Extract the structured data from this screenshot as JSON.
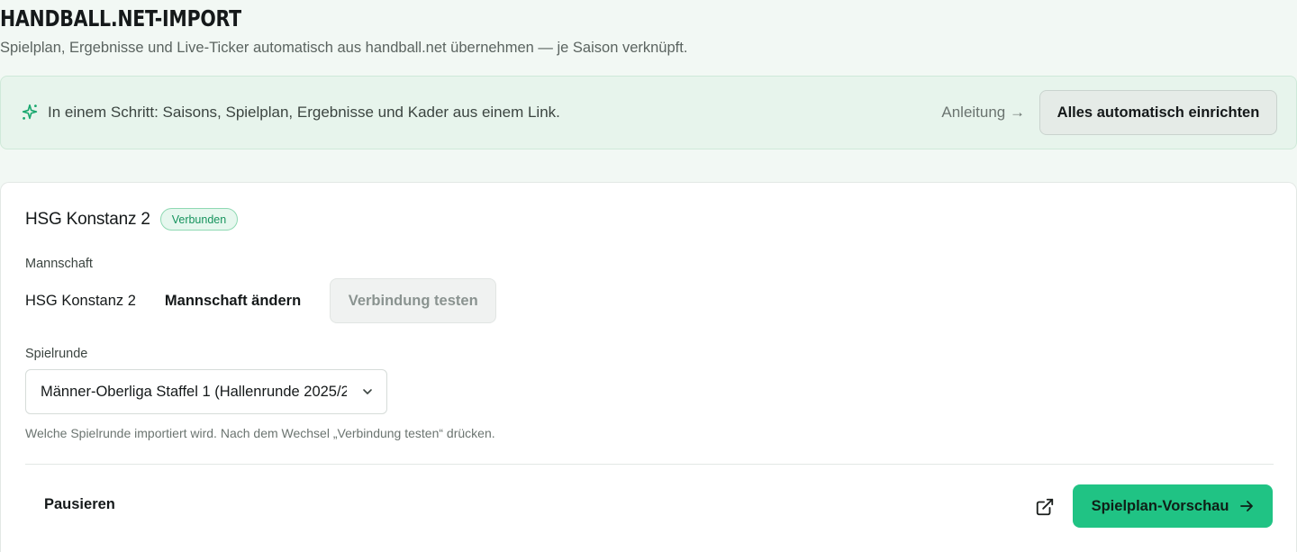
{
  "header": {
    "title": "HANDBALL.NET-IMPORT",
    "subtitle": "Spielplan, Ergebnisse und Live-Ticker automatisch aus handball.net übernehmen — je Saison verknüpft."
  },
  "banner": {
    "icon": "sparkles-icon",
    "text": "In einem Schritt: Saisons, Spielplan, Ergebnisse und Kader aus einem Link.",
    "guide_label": "Anleitung →",
    "auto_button_label": "Alles automatisch einrichten"
  },
  "team": {
    "name": "HSG Konstanz 2",
    "status_badge": "Verbunden"
  },
  "mannschaft": {
    "label": "Mannschaft",
    "value": "HSG Konstanz 2",
    "change_label": "Mannschaft ändern",
    "test_button_label": "Verbindung testen"
  },
  "spielrunde": {
    "label": "Spielrunde",
    "selected": "Männer-Oberliga Staffel 1 (Hallenrunde 2025/2",
    "hint": "Welche Spielrunde importiert wird. Nach dem Wechsel „Verbindung testen“ drücken."
  },
  "footer": {
    "pause_label": "Pausieren",
    "external_icon": "external-link-icon",
    "preview_button_label": "Spielplan-Vorschau",
    "preview_arrow_icon": "arrow-right-icon"
  },
  "colors": {
    "accent": "#20c384",
    "badge_text": "#16935d",
    "banner_bg": "#e7f4ec"
  }
}
